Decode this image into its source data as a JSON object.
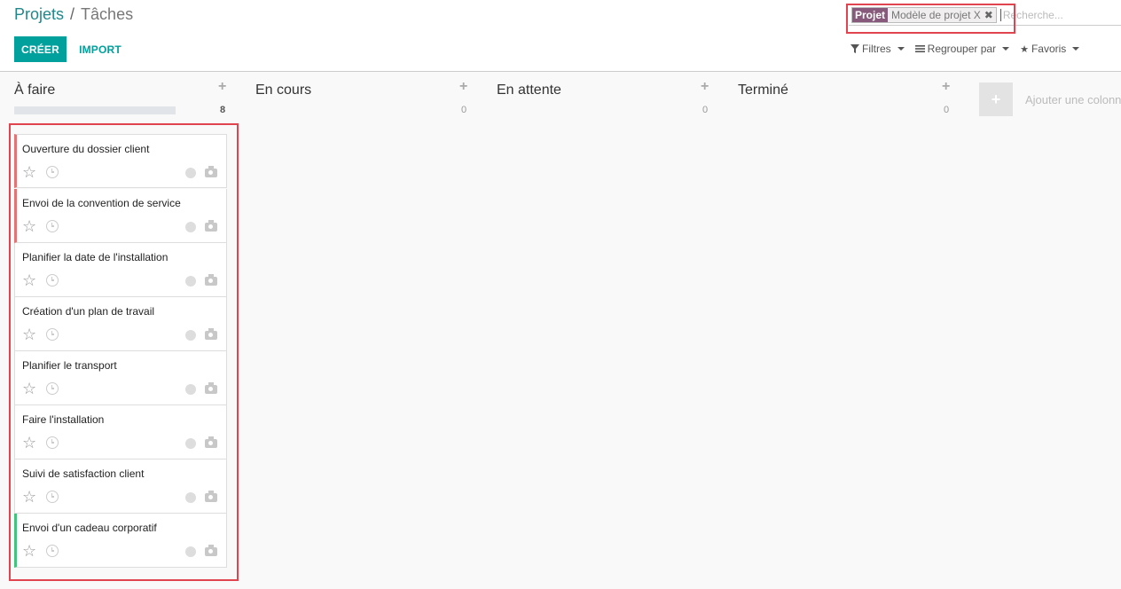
{
  "breadcrumb": {
    "parent": "Projets",
    "separator": "/",
    "current": "Tâches"
  },
  "toolbar": {
    "create_label": "CRÉER",
    "import_label": "IMPORT"
  },
  "search": {
    "facet_label": "Projet",
    "facet_value": "Modèle de projet X",
    "facet_remove": "✖",
    "placeholder": "Recherche..."
  },
  "search_options": {
    "filters": "Filtres",
    "group_by": "Regrouper par",
    "favorites": "Favoris"
  },
  "columns": [
    {
      "title": "À faire",
      "count": "8",
      "add": "+"
    },
    {
      "title": "En cours",
      "count": "0",
      "add": "+"
    },
    {
      "title": "En attente",
      "count": "0",
      "add": "+"
    },
    {
      "title": "Terminé",
      "count": "0",
      "add": "+"
    }
  ],
  "add_column": {
    "icon": "+",
    "label": "Ajouter une colonne"
  },
  "cards": [
    {
      "title": "Ouverture du dossier client",
      "priority_color": "#e57373"
    },
    {
      "title": "Envoi de la convention de service",
      "priority_color": "#e57373"
    },
    {
      "title": "Planifier la date de l'installation"
    },
    {
      "title": "Création d'un plan de travail"
    },
    {
      "title": "Planifier le transport"
    },
    {
      "title": "Faire l'installation"
    },
    {
      "title": "Suivi de satisfaction client"
    },
    {
      "title": "Envoi d'un cadeau corporatif",
      "priority_color": "#43c37b"
    }
  ],
  "colors": {
    "accent": "#00a09d",
    "facet": "#875a7b",
    "highlight": "#e0454f"
  }
}
